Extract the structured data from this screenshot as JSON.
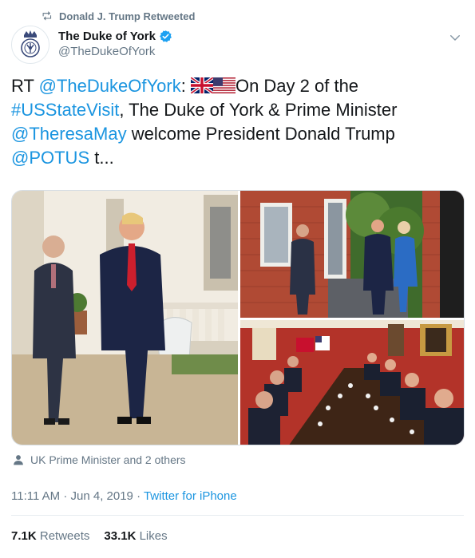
{
  "retweet": {
    "label": "Donald J. Trump Retweeted",
    "icon": "retweet-icon"
  },
  "author": {
    "display_name": "The Duke of York",
    "handle": "@TheDukeOfYork",
    "verified": true,
    "avatar_icon": "royal-cypher-icon"
  },
  "tweet": {
    "rt_prefix": "RT ",
    "mention_author": "@TheDukeOfYork",
    "colon": ":",
    "text_1": "On Day 2 of the",
    "hashtag": "#USStateVisit",
    "text_2": ", The Duke of York & Prime Minister",
    "mention_pm": "@TheresaMay",
    "text_3": " welcome President Donald Trump",
    "mention_potus": "@POTUS",
    "text_4": " t..."
  },
  "media": {
    "photos": [
      {
        "name": "photo-garden-walk"
      },
      {
        "name": "photo-handshake"
      },
      {
        "name": "photo-meeting-table"
      }
    ]
  },
  "tagged": {
    "text": "UK Prime Minister and 2 others"
  },
  "meta": {
    "time": "11:11 AM",
    "sep1": " · ",
    "date": "Jun 4, 2019",
    "sep2": " · ",
    "source": "Twitter for iPhone"
  },
  "stats": {
    "retweets_count": "7.1K",
    "retweets_label": "Retweets",
    "likes_count": "33.1K",
    "likes_label": "Likes"
  },
  "colors": {
    "link": "#1b95e0",
    "muted": "#657786",
    "text": "#14171a",
    "verified": "#1da1f2"
  }
}
